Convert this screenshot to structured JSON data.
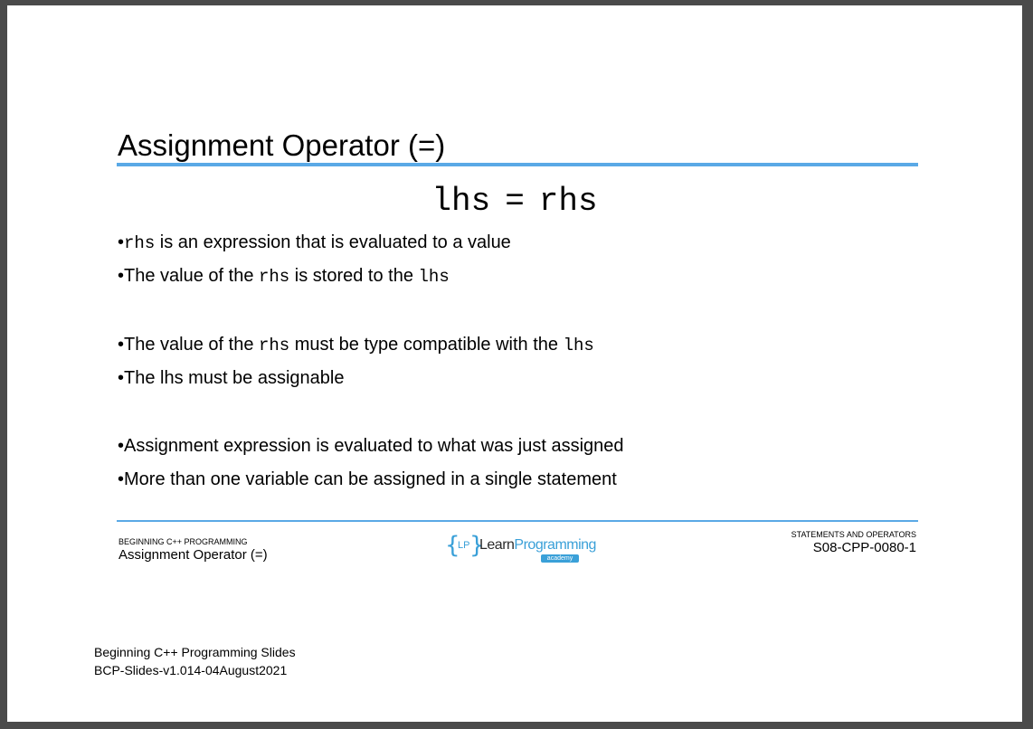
{
  "slide": {
    "title": "Assignment Operator (=)",
    "formula": {
      "lhs": "lhs",
      "op": "=",
      "rhs": "rhs"
    },
    "bullets": [
      {
        "marker": "•",
        "segments": [
          {
            "mono": true,
            "text": "rhs"
          },
          {
            "mono": false,
            "text": " is an expression that is evaluated to a value"
          }
        ]
      },
      {
        "marker": "•",
        "segments": [
          {
            "mono": false,
            "text": "The value of the "
          },
          {
            "mono": true,
            "text": "rhs"
          },
          {
            "mono": false,
            "text": " is stored to the "
          },
          {
            "mono": true,
            "text": "lhs"
          }
        ]
      },
      {
        "marker": "•",
        "segments": [
          {
            "mono": false,
            "text": "The value of the "
          },
          {
            "mono": true,
            "text": "rhs"
          },
          {
            "mono": false,
            "text": " must be type compatible with the "
          },
          {
            "mono": true,
            "text": "lhs"
          }
        ]
      },
      {
        "marker": "•",
        "segments": [
          {
            "mono": false,
            "text": "The lhs must be assignable"
          }
        ]
      },
      {
        "marker": "•",
        "segments": [
          {
            "mono": false,
            "text": "Assignment expression is evaluated to what was just assigned"
          }
        ]
      },
      {
        "marker": "•",
        "segments": [
          {
            "mono": false,
            "text": "More than one variable can be assigned in a single statement"
          }
        ]
      }
    ]
  },
  "footer": {
    "course": "BEGINNING C++ PROGRAMMING",
    "topic": "Assignment Operator (=)",
    "section": "STATEMENTS AND OPERATORS",
    "code": "S08-CPP-0080-1",
    "logo": {
      "brace_open": "{",
      "brace_close": "}",
      "initials": "LP",
      "word_main": "Learn",
      "word_accent": "Programming",
      "tagline": "academy"
    }
  },
  "document": {
    "line1": "Beginning C++ Programming Slides",
    "line2": "BCP-Slides-v1.014-04August2021"
  }
}
